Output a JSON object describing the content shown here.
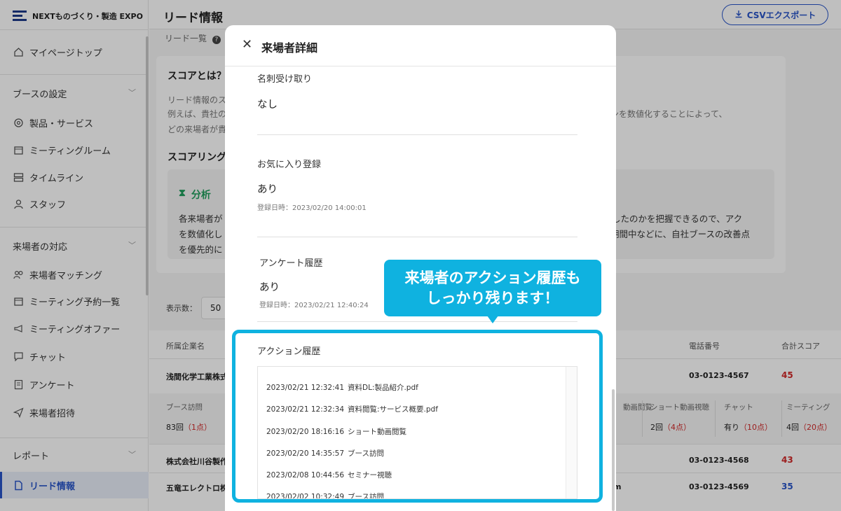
{
  "app": {
    "logo_text": "NEXTものづくり・製造 EXPO"
  },
  "sidebar": {
    "top_item": "マイページトップ",
    "sections": [
      {
        "label": "ブースの設定",
        "items": [
          "製品・サービス",
          "ミーティングルーム",
          "タイムライン",
          "スタッフ"
        ]
      },
      {
        "label": "来場者の対応",
        "items": [
          "来場者マッチング",
          "ミーティング予約一覧",
          "ミーティングオファー",
          "チャット",
          "アンケート",
          "来場者招待"
        ]
      },
      {
        "label": "レポート",
        "items": [
          "リード情報"
        ]
      }
    ]
  },
  "header": {
    "title": "リード情報",
    "csv_button": "CSVエクスポート",
    "breadcrumb": "リード一覧"
  },
  "score_card": {
    "title": "スコアとは？",
    "line1": "リード情報のス",
    "line2": "例えば、貴社の",
    "line2_right": "ンを数値化することによって、",
    "line3": "どの来場者が貴",
    "title2": "スコアリング",
    "analysis_head": "分析",
    "a1": "各来場者が",
    "a1_right": "したのかを把握できるので、アク",
    "a2": "を数値化し",
    "a2_right": "期間中などに、自社ブースの改善点",
    "a3": "を優先的に"
  },
  "list": {
    "display_count_label": "表示数：",
    "display_count_value": "50",
    "headers": {
      "company": "所属企業名",
      "phone": "電話番号",
      "total": "合計スコア"
    },
    "rows": [
      {
        "company": "浅間化学工業株式",
        "phone": "03-0123-4567",
        "score": "45"
      },
      {
        "company": "株式会社川谷製作",
        "phone": "03-0123-4568",
        "score": "43"
      },
      {
        "company": "五竜エレクトロ株",
        "extra": "m",
        "phone": "03-0123-4569",
        "score": "35"
      }
    ],
    "sub": {
      "booth_visit_label": "ブース訪問",
      "booth_visit_val": "83回",
      "booth_visit_pts": "（1点）",
      "video_label": "動画閲覧",
      "short_label": "ショート動画視聴",
      "short_val": "2回",
      "short_pts": "（4点）",
      "chat_label": "チャット",
      "chat_val": "有り",
      "chat_pts": "（10点）",
      "meeting_label": "ミーティング",
      "meeting_val": "4回",
      "meeting_pts": "（20点）"
    }
  },
  "modal": {
    "title": "来場者詳細",
    "fields": [
      {
        "label": "名刺受け取り",
        "value": "なし",
        "date": ""
      },
      {
        "label": "お気に入り登録",
        "value": "あり",
        "date": "登録日時：2023/02/20 14:00:01"
      },
      {
        "label": "アンケート履歴",
        "value": "あり",
        "date": "登録日時：2023/02/21 12:40:24"
      }
    ],
    "history_label": "アクション履歴",
    "history": [
      {
        "time": "2023/02/21 12:32:41",
        "action": "資料DL:製品紹介.pdf"
      },
      {
        "time": "2023/02/21 12:32:34",
        "action": "資料閲覧:サービス概要.pdf"
      },
      {
        "time": "2023/02/20 18:16:16",
        "action": "ショート動画閲覧"
      },
      {
        "time": "2023/02/20 14:35:57",
        "action": "ブース訪問"
      },
      {
        "time": "2023/02/08 10:44:56",
        "action": "セミナー視聴"
      },
      {
        "time": "2023/02/02 10:32:49",
        "action": "ブース訪問"
      }
    ]
  },
  "callout": {
    "line1": "来場者のアクション履歴も",
    "line2": "しっかり残ります！"
  },
  "colors": {
    "accent": "#2855c8",
    "highlight": "#0fb2e0",
    "score_red": "#d02828",
    "analysis_green": "#1f9e5c"
  }
}
